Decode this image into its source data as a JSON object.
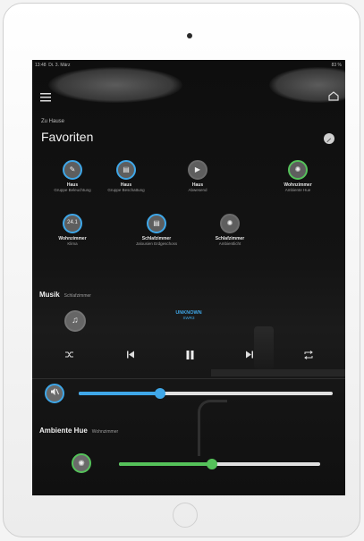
{
  "status": {
    "time": "13:48",
    "date": "Di. 3. März",
    "battery": "83 %"
  },
  "header": {
    "breadcrumb": "Zu Hause",
    "title": "Favoriten"
  },
  "favorites": [
    {
      "name": "Haus",
      "sub": "Gruppe Beleuchtung",
      "icon": "bulb-icon",
      "glyph": "✎",
      "ring": "blue"
    },
    {
      "name": "Haus",
      "sub": "Gruppe Beschattung",
      "icon": "blinds-icon",
      "glyph": "▤",
      "ring": "blue"
    },
    {
      "name": "Haus",
      "sub": "Abwesend",
      "icon": "play-icon",
      "glyph": "▶",
      "ring": "none"
    },
    {
      "name": "Wohnzimmer",
      "sub": "Ambiente Hue",
      "icon": "light-icon",
      "glyph": "✺",
      "ring": "green"
    },
    {
      "name": "Wohnzimmer",
      "sub": "Klima",
      "icon": "temperature-icon",
      "glyph": "24.1",
      "ring": "blue"
    },
    {
      "name": "Schlafzimmer",
      "sub": "Jalousien Erdgeschoss",
      "icon": "blinds-icon",
      "glyph": "▤",
      "ring": "blue"
    },
    {
      "name": "Schlafzimmer",
      "sub": "Ambientlicht",
      "icon": "light-icon",
      "glyph": "✺",
      "ring": "none"
    }
  ],
  "music": {
    "label": "Musik",
    "room": "Schlafzimmer",
    "track_title": "UNKNOWN",
    "track_artist": "SWR3",
    "volume_level": 0.32
  },
  "hue": {
    "label": "Ambiente Hue",
    "room": "Wohnzimmer",
    "brightness_level": 0.46
  },
  "colors": {
    "accent_blue": "#3fa7e8",
    "accent_green": "#55c25a"
  }
}
